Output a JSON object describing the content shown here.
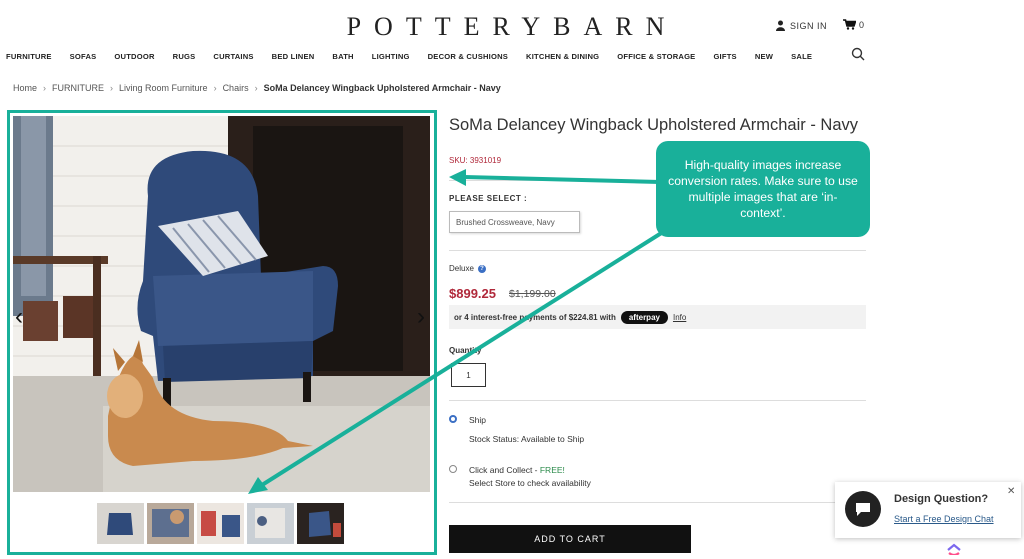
{
  "header": {
    "logo": "POTTERYBARN",
    "signin": "SIGN IN",
    "cart_count": "0"
  },
  "nav": [
    "FURNITURE",
    "SOFAS",
    "OUTDOOR",
    "RUGS",
    "CURTAINS",
    "BED LINEN",
    "BATH",
    "LIGHTING",
    "DECOR & CUSHIONS",
    "KITCHEN & DINING",
    "OFFICE & STORAGE",
    "GIFTS",
    "NEW",
    "SALE"
  ],
  "breadcrumb": [
    "Home",
    "FURNITURE",
    "Living Room Furniture",
    "Chairs",
    "SoMa Delancey Wingback Upholstered Armchair - Navy"
  ],
  "product": {
    "title": "SoMa Delancey Wingback Upholstered Armchair - Navy",
    "sku": "SKU: 3931019",
    "select_label": "PLEASE SELECT :",
    "swatch": "Brushed Crossweave, Navy",
    "tier": "Deluxe",
    "price": "$899.25",
    "old_price": "$1,199.00",
    "afterpay_text": "or 4 interest-free payments of $224.81 with",
    "afterpay_badge": "afterpay",
    "afterpay_info": "Info",
    "qty_label": "Quantity",
    "qty_value": "1",
    "ship_label": "Ship",
    "stock_status": "Stock Status: Available to Ship",
    "collect_label": "Click and Collect - ",
    "collect_free": "FREE!",
    "collect_sub": "Select Store to check availability",
    "add_to_cart": "ADD TO CART"
  },
  "callout": "High-quality images increase conversion rates. Make sure to use multiple images that are ‘in-context’.",
  "chat": {
    "title": "Design Question?",
    "link": "Start a Free Design Chat"
  },
  "colors": {
    "accent": "#19b09a",
    "price_red": "#b0283a",
    "chair_navy": "#2f4a7a"
  }
}
